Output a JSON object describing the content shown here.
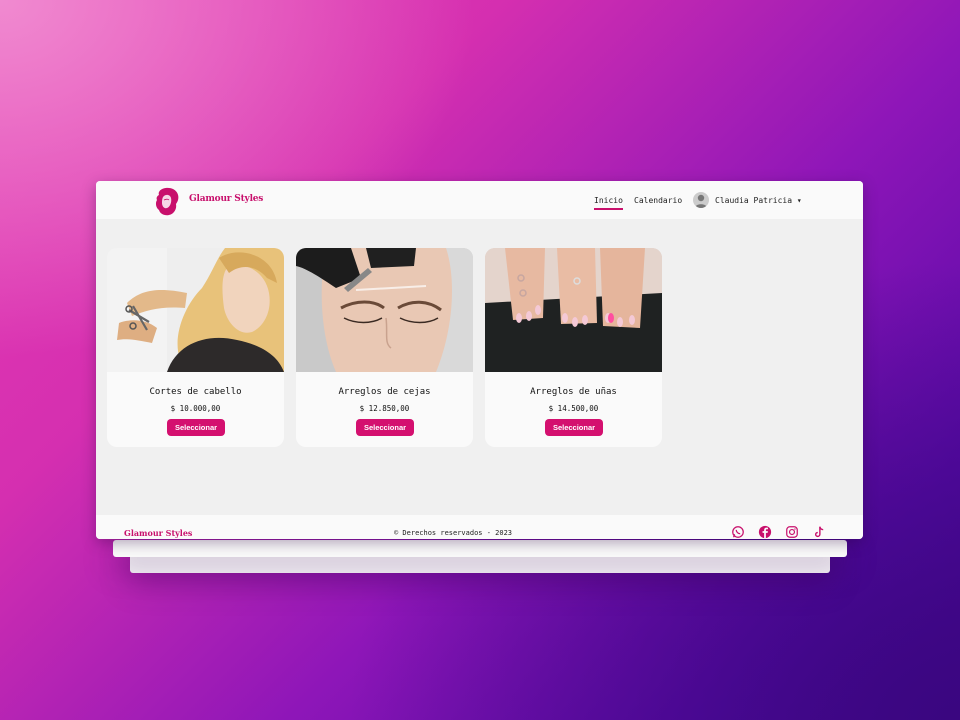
{
  "header": {
    "brand": "Glamour Styles",
    "nav": {
      "home": "Inicio",
      "calendar": "Calendario"
    },
    "user": {
      "name": "Claudia Patricia ▾"
    }
  },
  "services": [
    {
      "title": "Cortes de cabello",
      "price": "$ 10.000,00",
      "button": "Seleccionar"
    },
    {
      "title": "Arreglos de cejas",
      "price": "$ 12.850,00",
      "button": "Seleccionar"
    },
    {
      "title": "Arreglos de uñas",
      "price": "$ 14.500,00",
      "button": "Seleccionar"
    }
  ],
  "footer": {
    "brand": "Glamour Styles",
    "copyright": "© Derechos reservados - 2023",
    "social": [
      "whatsapp-icon",
      "facebook-icon",
      "instagram-icon",
      "tiktok-icon"
    ]
  },
  "colors": {
    "accent": "#d4106f",
    "brand": "#c8106c",
    "background": "#f0f0f0",
    "surface": "#fafafa"
  }
}
